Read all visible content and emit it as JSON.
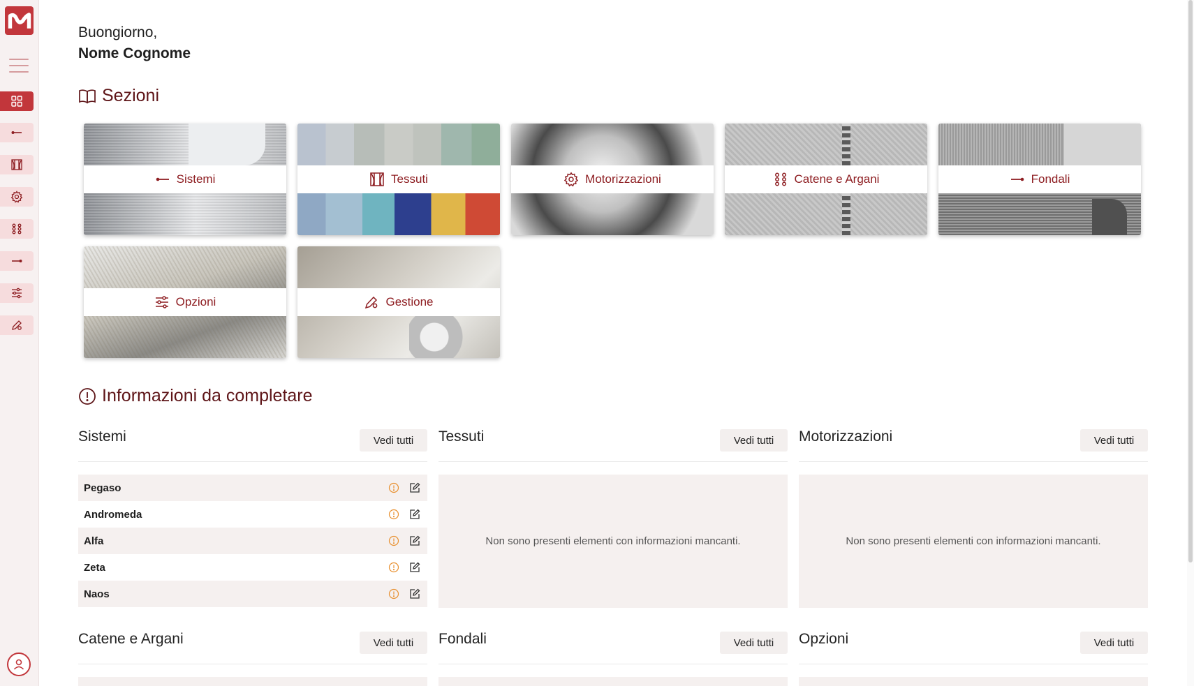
{
  "colors": {
    "accent": "#c2363b",
    "accent_dark": "#8e1e22",
    "title_dark": "#5e1518",
    "warn": "#e8902f",
    "row_bg": "#f5f0ef"
  },
  "sidebar": {
    "logo": "wave-logo",
    "items": [
      {
        "icon": "grid-icon",
        "active": true
      },
      {
        "icon": "arrow-left-icon"
      },
      {
        "icon": "curtain-icon"
      },
      {
        "icon": "gear-icon"
      },
      {
        "icon": "chain-icon"
      },
      {
        "icon": "rod-icon"
      },
      {
        "icon": "sliders-icon"
      },
      {
        "icon": "pen-gear-icon"
      }
    ]
  },
  "header": {
    "greeting": "Buongiorno,",
    "name": "Nome Cognome"
  },
  "sections": {
    "title": "Sezioni",
    "tiles": [
      {
        "label": "Sistemi",
        "icon": "arrow-left-icon"
      },
      {
        "label": "Tessuti",
        "icon": "curtain-icon"
      },
      {
        "label": "Motorizzazioni",
        "icon": "gear-icon"
      },
      {
        "label": "Catene e Argani",
        "icon": "chain-icon"
      },
      {
        "label": "Fondali",
        "icon": "rod-icon"
      },
      {
        "label": "Opzioni",
        "icon": "sliders-icon"
      },
      {
        "label": "Gestione",
        "icon": "pen-gear-icon"
      }
    ]
  },
  "info": {
    "title": "Informazioni da completare",
    "vedi": "Vedi tutti",
    "empty_text": "Non sono presenti elementi con informazioni mancanti.",
    "columns": [
      {
        "title": "Sistemi",
        "items": [
          "Pegaso",
          "Andromeda",
          "Alfa",
          "Zeta",
          "Naos"
        ]
      },
      {
        "title": "Tessuti",
        "items": []
      },
      {
        "title": "Motorizzazioni",
        "items": []
      },
      {
        "title": "Catene e Argani"
      },
      {
        "title": "Fondali"
      },
      {
        "title": "Opzioni"
      }
    ]
  }
}
